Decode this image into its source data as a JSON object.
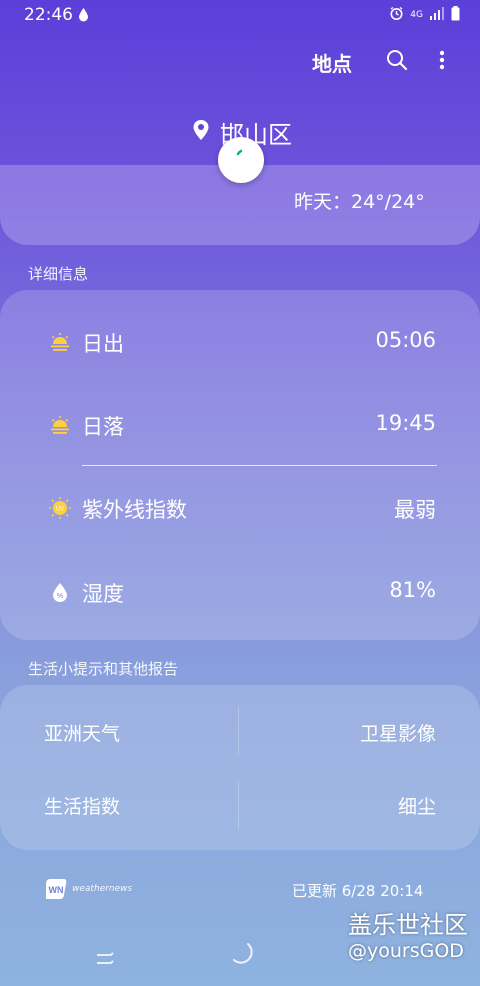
{
  "status_bar": {
    "time": "22:46",
    "network": "4G"
  },
  "app_bar": {
    "title": "地点"
  },
  "location": {
    "name": "邯山区",
    "yesterday": "昨天：24°/24°"
  },
  "details": {
    "section_label": "详细信息",
    "items": [
      {
        "icon": "sunrise-icon",
        "label": "日出",
        "value": "05:06"
      },
      {
        "icon": "sunset-icon",
        "label": "日落",
        "value": "19:45"
      },
      {
        "icon": "uv-icon",
        "label": "紫外线指数",
        "value": "最弱"
      },
      {
        "icon": "humidity-icon",
        "label": "湿度",
        "value": "81%"
      }
    ]
  },
  "tips": {
    "section_label": "生活小提示和其他报告",
    "items": [
      {
        "label": "亚洲天气"
      },
      {
        "label": "卫星影像"
      },
      {
        "label": "生活指数"
      },
      {
        "label": "细尘"
      }
    ]
  },
  "footer": {
    "provider": "weathernews",
    "updated": "已更新 6/28 20:14"
  },
  "watermark": {
    "line1": "盖乐世社区",
    "line2": "@yoursGOD"
  },
  "colors": {
    "sun": "#ffcf3f",
    "bg_top": "#5a3fd9",
    "bg_bottom": "#8eb3e0"
  }
}
